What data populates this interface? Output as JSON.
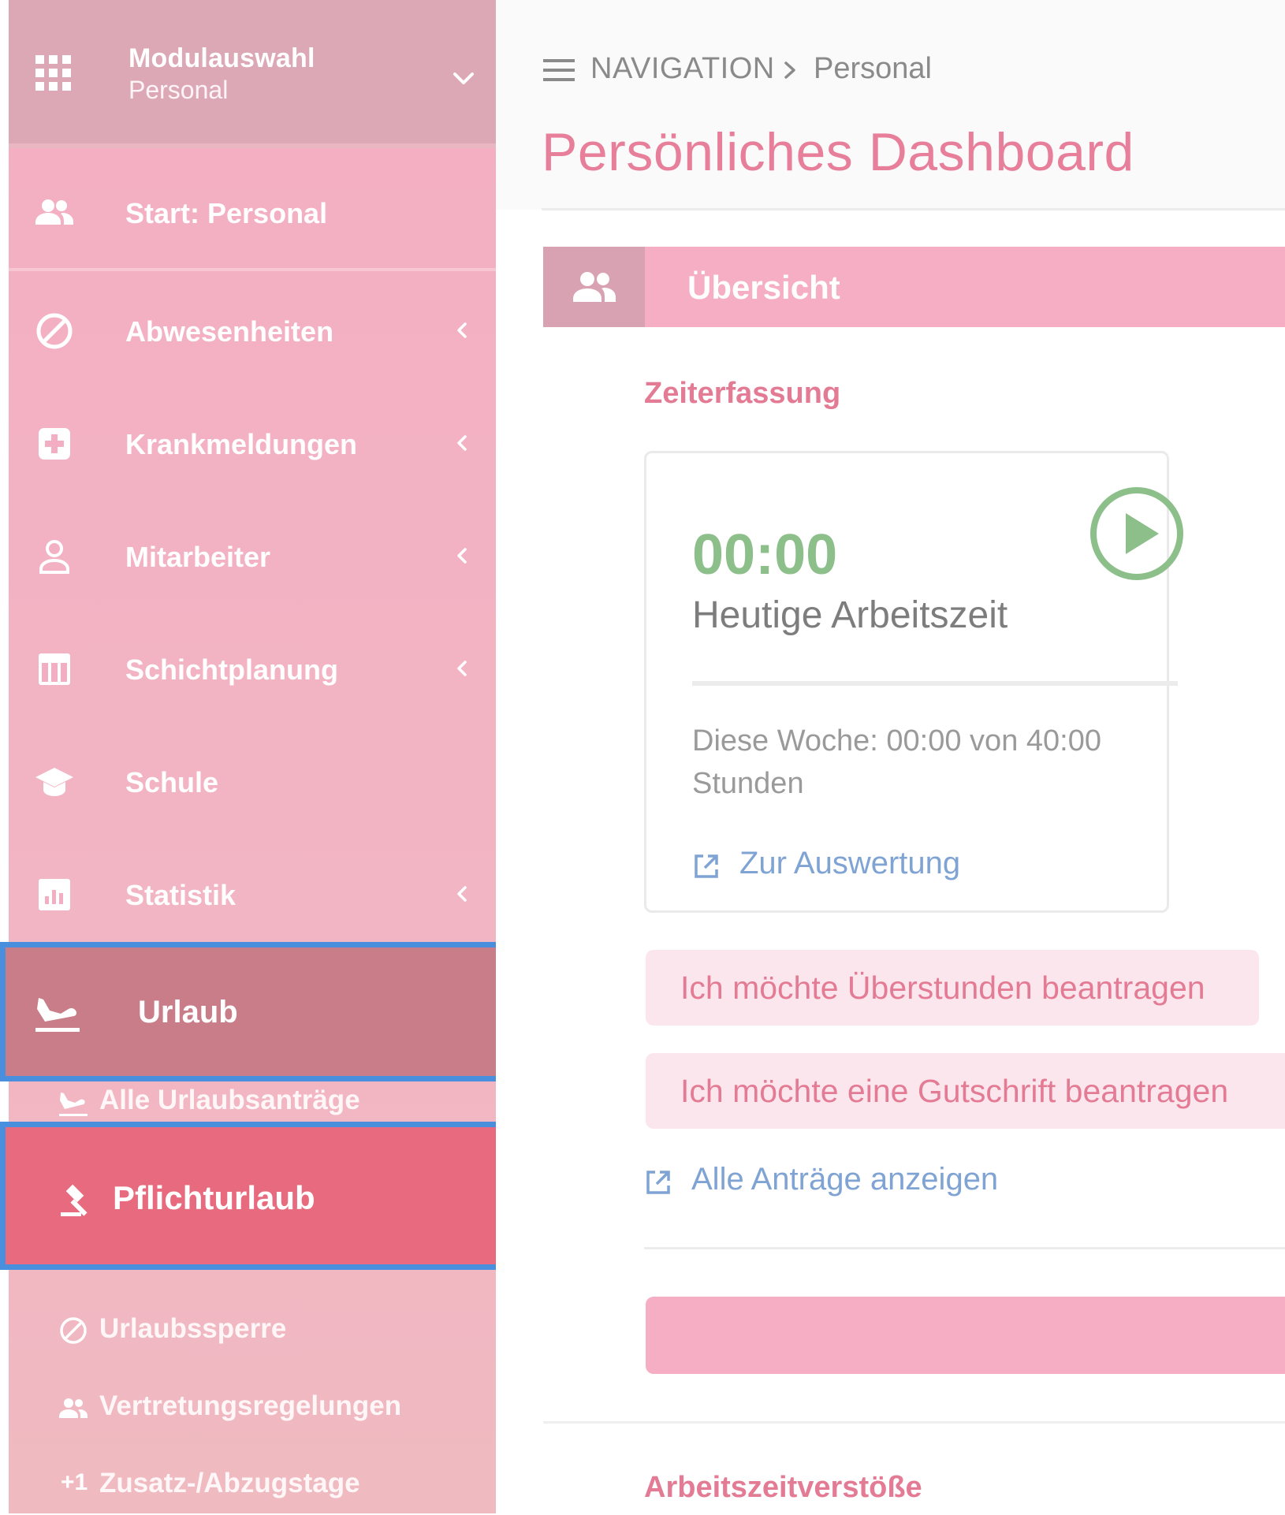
{
  "sidebar": {
    "module": {
      "title": "Modulauswahl",
      "subtitle": "Personal"
    },
    "items": [
      {
        "label": "Start: Personal"
      },
      {
        "label": "Abwesenheiten"
      },
      {
        "label": "Krankmeldungen"
      },
      {
        "label": "Mitarbeiter"
      },
      {
        "label": "Schichtplanung"
      },
      {
        "label": "Schule"
      },
      {
        "label": "Statistik"
      }
    ],
    "urlaub": {
      "label": "Urlaub",
      "children": [
        {
          "label": "Alle Urlaubsanträge"
        },
        {
          "label": "Pflichturlaub"
        },
        {
          "label": "Urlaubssperre"
        },
        {
          "label": "Vertretungsregelungen"
        },
        {
          "label": "Zusatz-/Abzugstage",
          "prefix": "+1"
        }
      ]
    }
  },
  "breadcrumb": {
    "root": "NAVIGATION",
    "current": "Personal"
  },
  "page_title": "Persönliches Dashboard",
  "panel": {
    "title": "Übersicht",
    "zeiterfassung": {
      "label": "Zeiterfassung",
      "time_value": "00:00",
      "time_label": "Heutige Arbeitszeit",
      "week_text": "Diese Woche: 00:00 von 40:00 Stunden",
      "eval_link": "Zur Auswertung"
    },
    "buttons": {
      "overtime": "Ich möchte Überstunden beantragen",
      "credit": "Ich möchte eine Gutschrift beantragen"
    },
    "all_requests_link": "Alle Anträge anzeigen",
    "next_section": "Arbeitszeitverstöße"
  },
  "colors": {
    "sidebar_bg": "#f4aec3",
    "active_item": "#e86a7e",
    "accent_pink": "#e47b95",
    "highlight_border": "#4a8fde",
    "time_green": "#8cbf8a",
    "link_blue": "#7fa3d3"
  }
}
